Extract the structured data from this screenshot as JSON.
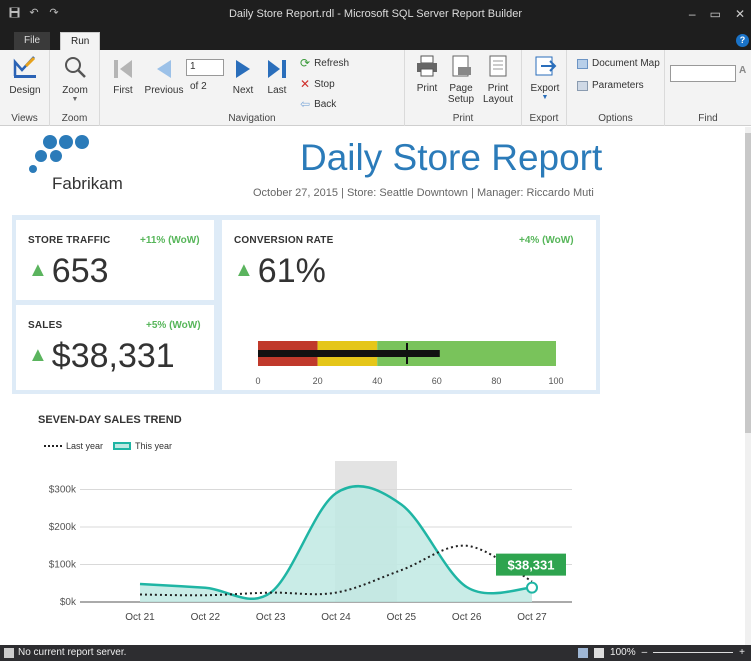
{
  "window": {
    "title": "Daily Store Report.rdl - Microsoft SQL Server Report Builder"
  },
  "tabs": {
    "file": "File",
    "run": "Run"
  },
  "ribbon": {
    "design": "Design",
    "zoom": "Zoom",
    "first": "First",
    "previous": "Previous",
    "page_value": "1",
    "of_pages": "of 2",
    "next": "Next",
    "last": "Last",
    "refresh": "Refresh",
    "stop": "Stop",
    "back": "Back",
    "print": "Print",
    "page_setup_1": "Page",
    "page_setup_2": "Setup",
    "print_layout_1": "Print",
    "print_layout_2": "Layout",
    "export": "Export",
    "document_map": "Document Map",
    "parameters": "Parameters",
    "groups": {
      "views": "Views",
      "zoom": "Zoom",
      "navigation": "Navigation",
      "print": "Print",
      "export": "Export",
      "options": "Options",
      "find": "Find"
    }
  },
  "report": {
    "brand": "Fabrikam",
    "title": "Daily Store Report",
    "subtitle": "October 27, 2015  |  Store: Seattle Downtown  |  Manager: Riccardo Muti",
    "kpis": {
      "traffic": {
        "label": "STORE TRAFFIC",
        "wow": "+11% (WoW)",
        "value": "653"
      },
      "sales": {
        "label": "SALES",
        "wow": "+5% (WoW)",
        "value": "$38,331"
      },
      "conversion": {
        "label": "CONVERSION RATE",
        "wow": "+4% (WoW)",
        "value": "61%"
      }
    },
    "gauge": {
      "ticks": [
        "0",
        "20",
        "40",
        "60",
        "80",
        "100"
      ],
      "bands": [
        {
          "from": 0,
          "to": 20,
          "color": "#c0392b"
        },
        {
          "from": 20,
          "to": 40,
          "color": "#e5c619"
        },
        {
          "from": 40,
          "to": 100,
          "color": "#79c35b"
        }
      ],
      "value": 61,
      "target": 50
    },
    "trend": {
      "title": "SEVEN-DAY SALES TREND",
      "legend_last": "Last year",
      "legend_this": "This year",
      "callout": "$38,331"
    }
  },
  "chart_data": {
    "type": "line",
    "title": "SEVEN-DAY SALES TREND",
    "categories": [
      "Oct 21",
      "Oct 22",
      "Oct 23",
      "Oct 24",
      "Oct 25",
      "Oct 26",
      "Oct 27"
    ],
    "y_ticks": [
      "$0k",
      "$100k",
      "$200k",
      "$300k"
    ],
    "ylim": [
      0,
      320
    ],
    "series": [
      {
        "name": "This year",
        "values": [
          48,
          38,
          25,
          290,
          260,
          40,
          38.331
        ],
        "color": "#1fb5a4"
      },
      {
        "name": "Last year",
        "values": [
          20,
          18,
          25,
          25,
          85,
          150,
          55
        ],
        "color": "#222222"
      }
    ],
    "highlight_category": "Oct 24",
    "legend_position": "top-left",
    "grid": true
  },
  "status": {
    "text": "No current report server.",
    "zoom": "100%"
  }
}
